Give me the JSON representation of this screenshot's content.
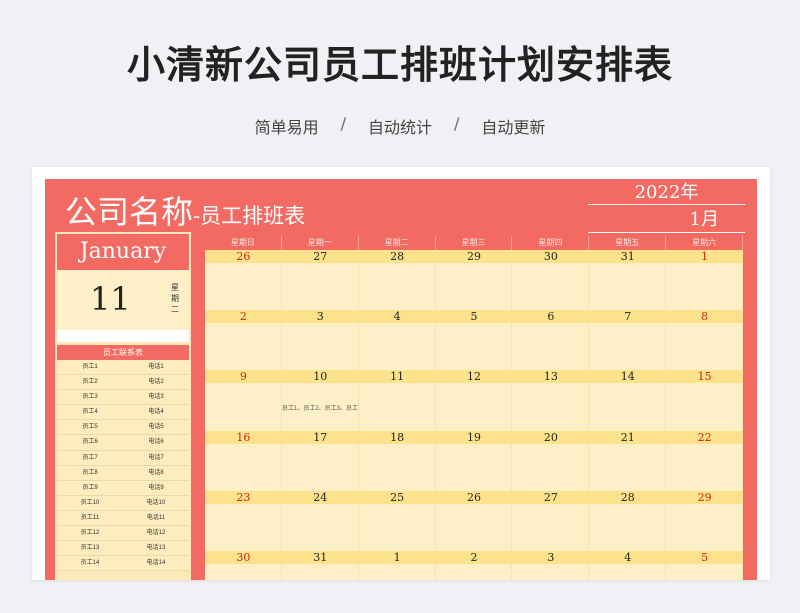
{
  "page": {
    "title": "小清新公司员工排班计划安排表",
    "features": [
      "简单易用",
      "自动统计",
      "自动更新"
    ],
    "separator": "/"
  },
  "sheet": {
    "company_name": "公司名称",
    "dash": "-",
    "subtitle": "员工排班表",
    "year": "2022年",
    "month": "1月",
    "accent_color": "#f26a62",
    "cell_color": "#fdecbd",
    "date_row_color": "#fde28c"
  },
  "today": {
    "month_name": "January",
    "day": "11",
    "weekday": "星期二"
  },
  "contacts": {
    "title": "员工联系表",
    "rows": [
      {
        "name": "员工1",
        "phone": "电话1"
      },
      {
        "name": "员工2",
        "phone": "电话2"
      },
      {
        "name": "员工3",
        "phone": "电话3"
      },
      {
        "name": "员工4",
        "phone": "电话4"
      },
      {
        "name": "员工5",
        "phone": "电话5"
      },
      {
        "name": "员工6",
        "phone": "电话6"
      },
      {
        "name": "员工7",
        "phone": "电话7"
      },
      {
        "name": "员工8",
        "phone": "电话8"
      },
      {
        "name": "员工9",
        "phone": "电话9"
      },
      {
        "name": "员工10",
        "phone": "电话10"
      },
      {
        "name": "员工11",
        "phone": "电话11"
      },
      {
        "name": "员工12",
        "phone": "电话12"
      },
      {
        "name": "员工13",
        "phone": "电话13"
      },
      {
        "name": "员工14",
        "phone": "电话14"
      }
    ]
  },
  "calendar": {
    "weekdays": [
      "星期日",
      "星期一",
      "星期二",
      "星期三",
      "星期四",
      "星期五",
      "星期六"
    ],
    "weeks": [
      [
        "26",
        "27",
        "28",
        "29",
        "30",
        "31",
        "1"
      ],
      [
        "2",
        "3",
        "4",
        "5",
        "6",
        "7",
        "8"
      ],
      [
        "9",
        "10",
        "11",
        "12",
        "13",
        "14",
        "15"
      ],
      [
        "16",
        "17",
        "18",
        "19",
        "20",
        "21",
        "22"
      ],
      [
        "23",
        "24",
        "25",
        "26",
        "27",
        "28",
        "29"
      ],
      [
        "30",
        "31",
        "1",
        "2",
        "3",
        "4",
        "5"
      ]
    ],
    "note": "员工1、员工2、员工3、员工"
  }
}
